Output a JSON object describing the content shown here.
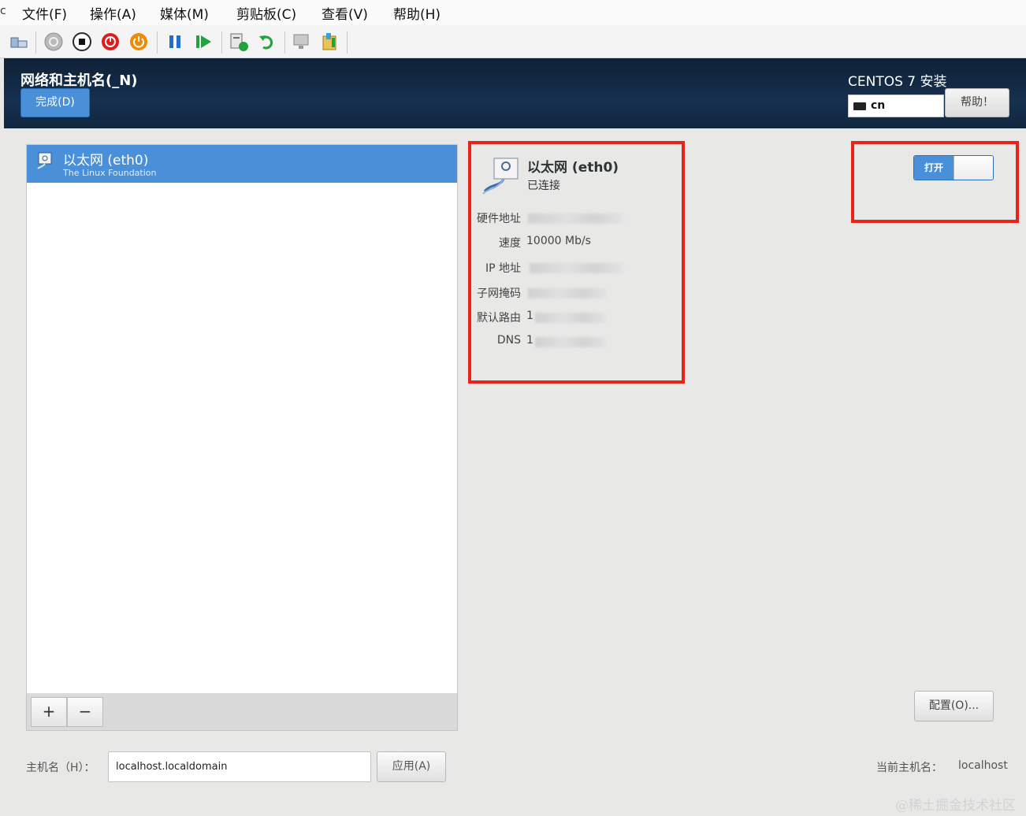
{
  "menubar": {
    "edge_mark": "c",
    "items": [
      {
        "label": "文件(F)"
      },
      {
        "label": "操作(A)"
      },
      {
        "label": "媒体(M)"
      },
      {
        "label": "剪贴板(C)"
      },
      {
        "label": "查看(V)"
      },
      {
        "label": "帮助(H)"
      }
    ]
  },
  "toolbar": {
    "icons": [
      "ctrl-alt-del-icon",
      "start-icon",
      "turn-off-icon",
      "shutdown-icon",
      "power-icon",
      "pause-icon",
      "resume-icon",
      "checkpoint-icon",
      "revert-icon",
      "enhanced-session-icon",
      "share-icon"
    ],
    "colors": {
      "red": "#e21b1b",
      "orange": "#f08a00",
      "blue": "#1e6fd0",
      "green": "#1fa33a"
    }
  },
  "header": {
    "title": "网络和主机名(_N)",
    "done_label": "完成(D)",
    "product": "CENTOS 7 安装",
    "keyboard_layout": "cn",
    "help_label": "帮助！"
  },
  "device_list": {
    "selected": {
      "name": "以太网 (eth0)",
      "vendor": "The Linux Foundation"
    },
    "add_label": "+",
    "remove_label": "−"
  },
  "details": {
    "name": "以太网 (eth0)",
    "status": "已连接",
    "rows": [
      {
        "label": "硬件地址",
        "value": ""
      },
      {
        "label": "速度",
        "value": "10000 Mb/s"
      },
      {
        "label": "IP 地址",
        "value": ""
      },
      {
        "label": "子网掩码",
        "value": ""
      },
      {
        "label": "默认路由",
        "value": "1"
      },
      {
        "label": "DNS",
        "value": "1"
      }
    ]
  },
  "toggle": {
    "on_label": "打开",
    "state": "on"
  },
  "configure_label": "配置(O)...",
  "hostname": {
    "label": "主机名（H）：",
    "value": "localhost.localdomain",
    "apply_label": "应用(A)",
    "current_label": "当前主机名：",
    "current_value": "localhost"
  },
  "highlight_color": "#e8231c",
  "accent_color": "#4a90d9",
  "watermark": "@稀土掘金技术社区"
}
